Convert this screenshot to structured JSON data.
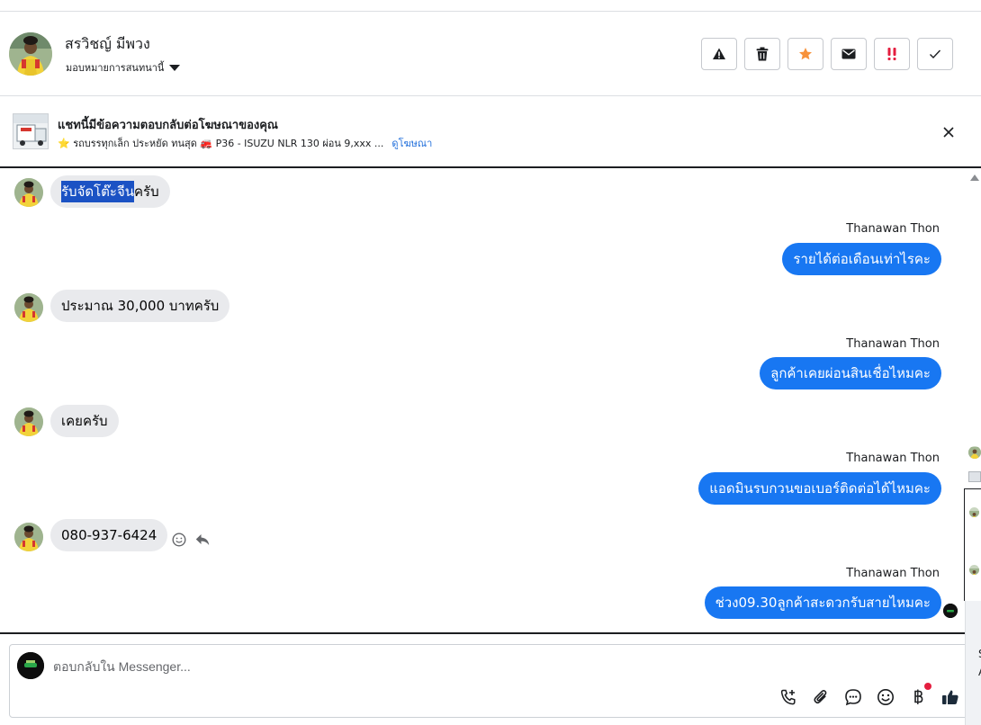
{
  "header": {
    "contact_name": "สรวิชญ์ มีพวง",
    "assign_label": "มอบหมายการสนทนานี้",
    "actions": [
      {
        "name": "report-spam-button",
        "icon": "warning-icon"
      },
      {
        "name": "delete-button",
        "icon": "trash-icon"
      },
      {
        "name": "star-button",
        "icon": "star-icon"
      },
      {
        "name": "mark-unread-button",
        "icon": "envelope-icon"
      },
      {
        "name": "important-button",
        "icon": "double-exclamation-icon"
      },
      {
        "name": "mark-done-button",
        "icon": "check-icon"
      }
    ],
    "accent_star": "#f7923b",
    "accent_important": "#e41e3f"
  },
  "ad": {
    "title": "แชทนี้มีข้อความตอบกลับต่อโฆษณาของคุณ",
    "subtitle": "⭐ รถบรรทุกเล็ก ประหยัด ทนสุด 🚒 P36 - ISUZU NLR 130 ผ่อน 9,xxx ...",
    "link_label": "ดูโฆษณา"
  },
  "messages": [
    {
      "direction": "in",
      "text_highlighted": "รับจัดโต๊ะจีน",
      "text_rest": "ครับ"
    },
    {
      "direction": "out",
      "sender": "Thanawan Thon",
      "text": "รายได้ต่อเดือนเท่าไรคะ"
    },
    {
      "direction": "in",
      "text": "ประมาณ 30,000 บาทครับ"
    },
    {
      "direction": "out",
      "sender": "Thanawan Thon",
      "text": "ลูกค้าเคยผ่อนสินเชื่อไหมคะ"
    },
    {
      "direction": "in",
      "text": "เคยครับ"
    },
    {
      "direction": "out",
      "sender": "Thanawan Thon",
      "text": "แอดมินรบกวนขอเบอร์ติดต่อได้ไหมคะ"
    },
    {
      "direction": "in",
      "text": "080-937-6424"
    },
    {
      "direction": "out",
      "sender": "Thanawan Thon",
      "text": "ช่วง09.30ลูกค้าสะดวกรับสายไหมคะ"
    }
  ],
  "composer": {
    "placeholder": "ตอบกลับใน Messenger...",
    "tools": [
      "add-call-icon",
      "attachment-icon",
      "saved-replies-icon",
      "emoji-icon",
      "baht-payment-icon",
      "thumbs-up-icon"
    ]
  },
  "colors": {
    "outgoing_bubble": "#1877f2",
    "incoming_bubble": "#e9eaed",
    "link": "#216fdb"
  },
  "side_panel": {
    "letter_1": "S",
    "letter_2": "A"
  }
}
